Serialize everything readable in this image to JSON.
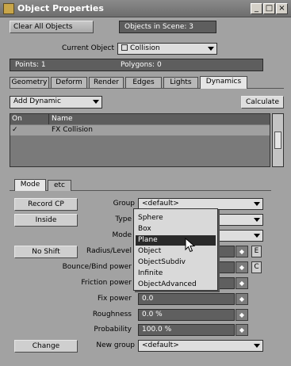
{
  "window": {
    "title": "Object Properties",
    "minimize_glyph": "_",
    "maximize_glyph": "□",
    "close_glyph": "×"
  },
  "top": {
    "clear_all_label": "Clear All Objects",
    "objects_in_scene": "Objects in Scene: 3"
  },
  "current_object": {
    "label": "Current Object",
    "value": "Collision"
  },
  "stats": {
    "points": "Points: 1",
    "polygons": "Polygons: 0"
  },
  "tabs": [
    "Geometry",
    "Deform",
    "Render",
    "Edges",
    "Lights",
    "Dynamics"
  ],
  "active_tab": "Dynamics",
  "dynamics": {
    "add_dynamic_label": "Add Dynamic",
    "calculate_label": "Calculate",
    "list_headers": {
      "on": "On",
      "name": "Name"
    },
    "list_rows": [
      {
        "on": "✓",
        "name": "FX Collision"
      }
    ]
  },
  "subtabs": [
    "Mode",
    "etc"
  ],
  "mode": {
    "record_cp": "Record CP",
    "inside": "Inside",
    "no_shift": "No Shift",
    "change": "Change",
    "rows": {
      "group": {
        "label": "Group",
        "value": "<default>"
      },
      "type": {
        "label": "Type",
        "value": ""
      },
      "mode": {
        "label": "Mode",
        "value": ""
      },
      "radius": {
        "label": "Radius/Level",
        "value": ""
      },
      "bounce": {
        "label": "Bounce/Bind power",
        "value": ""
      },
      "friction": {
        "label": "Friction power",
        "value": ""
      },
      "fix": {
        "label": "Fix power",
        "value": "0.0"
      },
      "roughness": {
        "label": "Roughness",
        "value": "0.0 %"
      },
      "probability": {
        "label": "Probability",
        "value": "100.0 %"
      },
      "new_group": {
        "label": "New group",
        "value": "<default>"
      }
    },
    "e_label": "E",
    "c_label": "C",
    "spin_glyph": "◆"
  },
  "type_menu": {
    "items": [
      "Sphere",
      "Box",
      "Plane",
      "Object",
      "ObjectSubdiv",
      "Infinite",
      "ObjectAdvanced"
    ],
    "selected": "Plane"
  }
}
